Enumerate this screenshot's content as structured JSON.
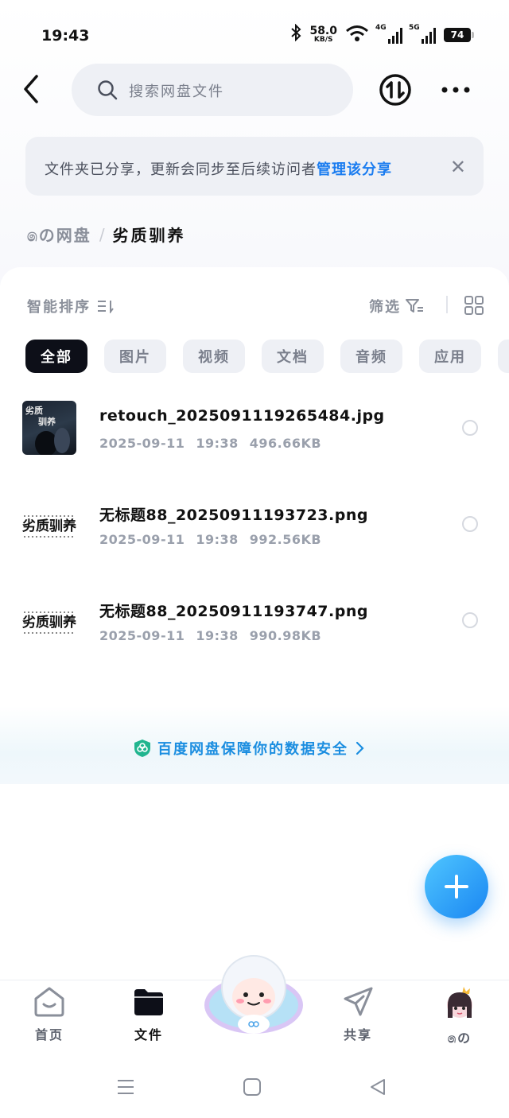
{
  "status_bar": {
    "time": "19:43",
    "speed_value": "58.0",
    "speed_unit": "KB/S",
    "net1": "4G",
    "net2": "5G",
    "battery": "74"
  },
  "header": {
    "search_placeholder": "搜索网盘文件"
  },
  "notice": {
    "text": "文件夹已分享，更新会同步至后续访问者",
    "link": "管理该分享",
    "close": "✕"
  },
  "breadcrumb": {
    "root": "෧の网盘",
    "separator": "/",
    "current": "劣质驯养"
  },
  "toolbar": {
    "sort_label": "智能排序",
    "filter_label": "筛选"
  },
  "chips": [
    {
      "label": "全部"
    },
    {
      "label": "图片"
    },
    {
      "label": "视频"
    },
    {
      "label": "文档"
    },
    {
      "label": "音频"
    },
    {
      "label": "应用"
    }
  ],
  "files": [
    {
      "name": "retouch_2025091119265484.jpg",
      "date": "2025-09-11",
      "time": "19:38",
      "size": "496.66KB"
    },
    {
      "name": "无标题88_20250911193723.png",
      "date": "2025-09-11",
      "time": "19:38",
      "size": "992.56KB"
    },
    {
      "name": "无标题88_20250911193747.png",
      "date": "2025-09-11",
      "time": "19:38",
      "size": "990.98KB"
    }
  ],
  "thumb_text": {
    "small": "劣质",
    "big": "驯养",
    "wide": "劣质驯养"
  },
  "safety": {
    "text": "百度网盘保障你的数据安全"
  },
  "tabs": [
    {
      "label": "首页"
    },
    {
      "label": "文件"
    },
    {
      "label": "共享"
    },
    {
      "label": "෧の"
    }
  ],
  "colors": {
    "accent": "#1a7cf0",
    "chip_active": "#0d0f18",
    "fab": "#1a86f2"
  }
}
